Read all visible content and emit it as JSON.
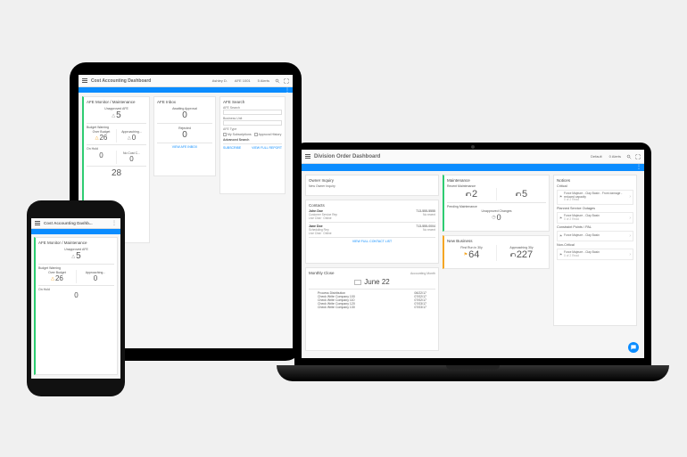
{
  "accent": "#0a8cff",
  "cost_accounting": {
    "title": "Cost Accounting Dashboard",
    "phone_title": "Cost Accounting Dashb...",
    "user": "Ashley D.",
    "context": "AFE 1001",
    "alerts": "5 Alerts",
    "cards": {
      "afe_monitor": {
        "title": "AFE Monitor / Maintenance",
        "unapproved": {
          "label": "Unapproved AFE",
          "value": "5"
        },
        "budget_warning_label": "Budget Warning",
        "over_budget": {
          "label": "Over Budget",
          "value": "26"
        },
        "approaching": {
          "label": "Approaching...",
          "value": "0"
        },
        "on_hold_label": "On Hold",
        "on_hold": {
          "value": "0"
        },
        "no_cost": {
          "label": "No Cost C...",
          "value": "0"
        },
        "bottom_value": "28"
      },
      "afe_inbox": {
        "title": "AFE Inbox",
        "awaiting": {
          "label": "Awaiting Approval",
          "value": "0"
        },
        "rejected": {
          "label": "Rejected",
          "value": "0"
        },
        "link": "VIEW AFE INBOX"
      },
      "afe_search": {
        "title": "AFE Search",
        "field1": "AFE Search",
        "field2": "Business Unit",
        "field3": "AFE Type",
        "opt1": "My Subscriptions",
        "opt2": "Approval History",
        "advanced": "Advanced Search",
        "link_subscribe": "SUBSCRIBE",
        "link_view": "VIEW FULL REPORT"
      }
    }
  },
  "division_order": {
    "title": "Division Order Dashboard",
    "context": "Default",
    "alerts": "0 Alerts",
    "panels": {
      "owner_inquiry": {
        "title": "Owner Inquiry",
        "link": "New Owner Inquiry"
      },
      "contacts": {
        "title": "Contacts",
        "rows": [
          {
            "name": "John Doe",
            "role": "Customer Service Rep",
            "status": "Live Chat · Online",
            "phone": "713-555-5555",
            "sub": "No recent"
          },
          {
            "name": "Jane Doe",
            "role": "Scheduling Rep",
            "status": "Live Chat · Online",
            "phone": "713-555-0004",
            "sub": "No recent"
          }
        ],
        "link": "VIEW FULL CONTACT LIST"
      },
      "maintenance": {
        "title": "Maintenance",
        "recent_label": "Recent Maintenance",
        "recent": {
          "a_label": "",
          "a_value": "2",
          "b_label": "",
          "b_value": "5"
        },
        "pending_label": "Pending Maintenance",
        "pending": {
          "label": "Unapproved Changes",
          "value": "0"
        }
      },
      "new_business": {
        "title": "New Business",
        "a": {
          "label": "First Run in 30y",
          "value": "64"
        },
        "b": {
          "label": "Approaching 30y",
          "value": "227"
        }
      },
      "monthly_close": {
        "title": "Monthly Close",
        "subtitle": "Accounting Month",
        "month": "June 22",
        "rows": [
          {
            "label": "Process Distribution",
            "date": "06/22/17"
          },
          {
            "label": "Check Write Company 100",
            "date": "07/02/17"
          },
          {
            "label": "Check Write Company 110",
            "date": "07/02/17"
          },
          {
            "label": "Check Write Company 120",
            "date": "07/03/17"
          },
          {
            "label": "Check Write Company 130",
            "date": "07/03/17"
          }
        ]
      },
      "notices": {
        "title": "Notices",
        "groups": [
          {
            "label": "Critical",
            "items": [
              {
                "line1": "Force Majeure - Clay Basin - Front damage - reduced capacity",
                "line2": "0 of 2 Read"
              }
            ]
          },
          {
            "label": "Planned Service Outages",
            "items": [
              {
                "line1": "Force Majeure - Clay Basin",
                "line2": "0 of 2 Read"
              }
            ]
          },
          {
            "label": "Constraint Points / PAL",
            "items": [
              {
                "line1": "Force Majeure - Clay Basin",
                "line2": ""
              }
            ]
          },
          {
            "label": "Non-Critical",
            "items": [
              {
                "line1": "Force Majeure - Clay Basin",
                "line2": "0 of 2 Read"
              }
            ]
          }
        ]
      }
    }
  }
}
